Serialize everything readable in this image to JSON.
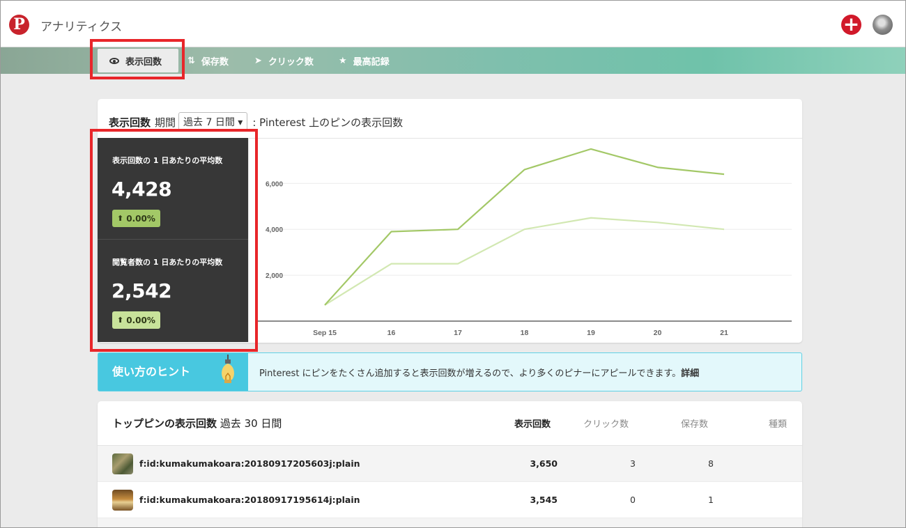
{
  "header": {
    "app_title": "アナリティクス",
    "logo_glyph": "P",
    "add_glyph": "+"
  },
  "nav": {
    "tabs": [
      {
        "label": "表示回数",
        "icon": "eye-icon",
        "active": true
      },
      {
        "label": "保存数",
        "icon": "save-icon",
        "active": false
      },
      {
        "label": "クリック数",
        "icon": "cursor-icon",
        "active": false
      },
      {
        "label": "最高記録",
        "icon": "star-icon",
        "active": false
      }
    ]
  },
  "main_card": {
    "title": "表示回数",
    "period_label": "期間",
    "period_select": "過去 7 日間 ▾",
    "description": ": Pinterest 上のピンの表示回数",
    "stats": [
      {
        "label": "表示回数の 1 日あたりの平均数",
        "value": "4,428",
        "change": "0.00%",
        "color": "#a3c867"
      },
      {
        "label": "閲覧者数の 1 日あたりの平均数",
        "value": "2,542",
        "change": "0.00%",
        "color": "#c8e29a"
      }
    ]
  },
  "chart_data": {
    "type": "line",
    "categories": [
      "Sep 15",
      "16",
      "17",
      "18",
      "19",
      "20",
      "21"
    ],
    "y_ticks": [
      "2,000",
      "4,000",
      "6,000"
    ],
    "ylim": [
      0,
      7800
    ],
    "grid": true,
    "series": [
      {
        "name": "表示回数",
        "color": "#a3c867",
        "values": [
          700,
          3900,
          4000,
          6600,
          7500,
          6700,
          6400
        ]
      },
      {
        "name": "閲覧者数",
        "color": "#d2e8b2",
        "values": [
          700,
          2500,
          2500,
          4000,
          4500,
          4300,
          4000
        ]
      }
    ]
  },
  "hint": {
    "title": "使い方のヒント",
    "text": "Pinterest にピンをたくさん追加すると表示回数が増えるので、より多くのピナーにアピールできます。",
    "more_link": "詳細"
  },
  "top_pins": {
    "title": "トップピンの表示回数",
    "period": "過去 30 日間",
    "columns": [
      "表示回数",
      "クリック数",
      "保存数",
      "種類"
    ],
    "rows": [
      {
        "name": "f:id:kumakumakoara:20180917205603j:plain",
        "impressions": "3,650",
        "clicks": "3",
        "saves": "8"
      },
      {
        "name": "f:id:kumakumakoara:20180917195614j:plain",
        "impressions": "3,545",
        "clicks": "0",
        "saves": "1"
      }
    ]
  }
}
